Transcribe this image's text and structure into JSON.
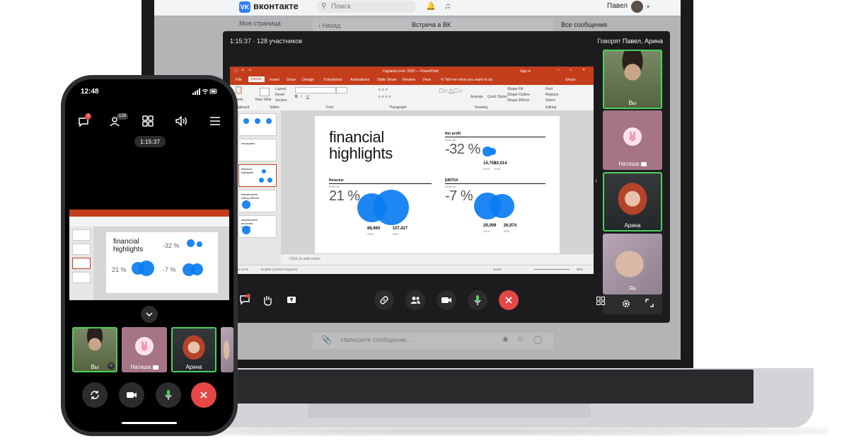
{
  "laptop": {
    "vk_header": {
      "logo_text": "вконтакте",
      "search_placeholder": "Поиск",
      "user_name": "Павел"
    },
    "vk_page": {
      "left_item": "Моя страница",
      "back_label": "Назад",
      "chat_title": "Встреча в ВК",
      "all_messages": "Все сообщения",
      "message_placeholder": "Напишите сообщение..."
    },
    "call": {
      "status": "1:15:37 · 128 участников",
      "speaking_prefix": "Говорят",
      "speaking_names": "Павел, Арина",
      "participants": [
        {
          "name": "Вы",
          "speaking": true
        },
        {
          "name": "Наташа",
          "speaking": false
        },
        {
          "name": "Арина",
          "speaking": true
        },
        {
          "name": "Ян",
          "speaking": false
        }
      ]
    },
    "ppt": {
      "window_title": "Годовой отчёт 2020 — PowerPoint",
      "sign_in": "Sign in",
      "tabs": [
        "File",
        "Home",
        "Insert",
        "Draw",
        "Design",
        "Transitions",
        "Animations",
        "Slide Show",
        "Review",
        "View"
      ],
      "tell_me": "Tell me what you want to do",
      "share": "Share",
      "ribbon": {
        "paste": "Paste",
        "layout": "Layout",
        "reset": "Reset",
        "section": "Section",
        "new_slide": "New Slide",
        "clipboard": "Clipboard",
        "slides": "Slides",
        "font": "Font",
        "paragraph": "Paragraph",
        "drawing": "Drawing",
        "editing": "Editing",
        "arrange": "Arrange",
        "quick_styles": "Quick Styles",
        "shape_fill": "Shape Fill",
        "shape_outline": "Shape Outline",
        "shape_effects": "Shape Effects",
        "find": "Find",
        "replace": "Replace",
        "select": "Select"
      },
      "thumb_labels": [
        "employees",
        "financial highlights",
        "shareholders voting interest",
        "shareholders economic interest"
      ],
      "notes_placeholder": "Click to add notes",
      "status_left": "40 of 42",
      "status_lang": "English (United Kingdom)",
      "status_notes": "Notes",
      "zoom": "88%"
    },
    "slide": {
      "title_line1": "financial",
      "title_line2": "highlights",
      "blocks": [
        {
          "label": "Net profit",
          "unit": "RUB mn",
          "change": "-32 %",
          "v1": "14,755",
          "y1": "2019",
          "v2": "10,014",
          "y2": "2020",
          "bubble1": 0.55,
          "bubble2": 0.38
        },
        {
          "label": "Revenue",
          "unit": "RUB mn",
          "change": "21 %",
          "v1": "88,660",
          "y1": "2019",
          "v2": "107,427",
          "y2": "2020",
          "bubble1": 0.82,
          "bubble2": 1.0
        },
        {
          "label": "EBITDA",
          "unit": "RUB mn",
          "change": "-7 %",
          "v1": "29,099",
          "y1": "2019",
          "v2": "26,974",
          "y2": "2020",
          "bubble1": 0.82,
          "bubble2": 0.76
        }
      ],
      "colors": {
        "bubble": "#0a7cf2"
      }
    }
  },
  "phone": {
    "status_time": "12:48",
    "chat_badge": "3",
    "participants_badge": "128",
    "timer": "1:15:37",
    "participants": [
      {
        "name": "Вы",
        "speaking": true
      },
      {
        "name": "Наташа",
        "speaking": false
      },
      {
        "name": "Арина",
        "speaking": true
      }
    ],
    "slide": {
      "title_line1": "financial",
      "title_line2": "highlights",
      "change_net": "-32 %",
      "change_rev": "21 %",
      "change_ebitda": "-7 %"
    }
  },
  "colors": {
    "accent_red": "#e64646",
    "speaker_green": "#4bd05c",
    "vk_blue": "#2f7ff5",
    "ppt_orange": "#c43e1c"
  }
}
